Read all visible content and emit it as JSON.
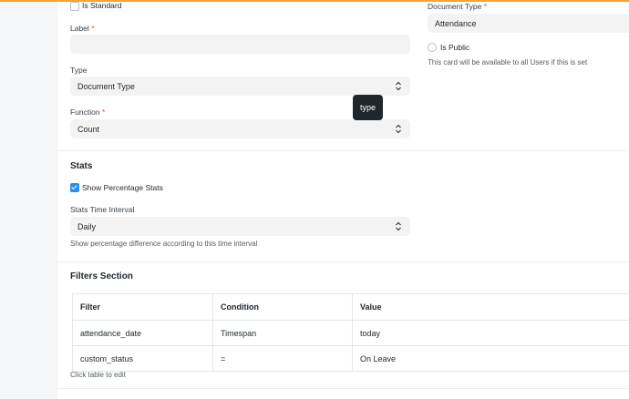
{
  "form": {
    "is_standard_label": "Is Standard",
    "label_label": "Label",
    "required_mark": "*",
    "label_value": "",
    "type_label": "Type",
    "type_value": "Document Type",
    "function_label": "Function",
    "function_value": "Count",
    "document_type_label": "Document Type",
    "document_type_value": "Attendance",
    "is_public_label": "Is Public",
    "is_public_help": "This card will be available to all Users if this is set"
  },
  "tooltip": {
    "text": "type"
  },
  "stats": {
    "title": "Stats",
    "show_percentage_label": "Show Percentage Stats",
    "show_percentage_checked": true,
    "time_interval_label": "Stats Time Interval",
    "time_interval_value": "Daily",
    "time_interval_help": "Show percentage difference according to this time interval"
  },
  "filters": {
    "title": "Filters Section",
    "columns": [
      "Filter",
      "Condition",
      "Value"
    ],
    "rows": [
      [
        "attendance_date",
        "Timespan",
        "today"
      ],
      [
        "custom_status",
        "=",
        "On Leave"
      ]
    ],
    "help": "Click table to edit"
  },
  "colors": {
    "accent": "#f5a33b",
    "checkbox_checked": "#2490ef",
    "required": "#e24c4c",
    "tooltip_bg": "#1f272e"
  }
}
